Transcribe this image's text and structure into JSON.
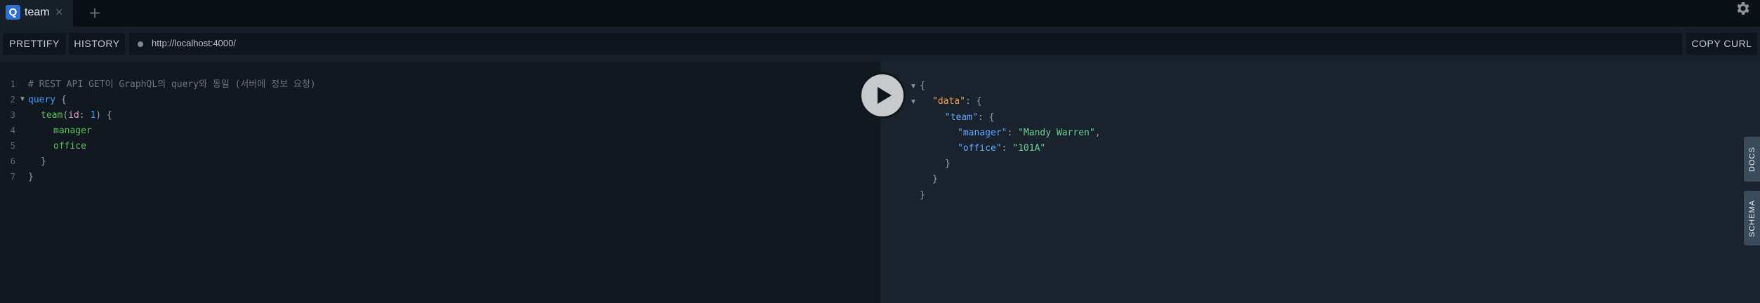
{
  "tab": {
    "badge": "Q",
    "title": "team",
    "close": "×",
    "add": "+"
  },
  "toolbar": {
    "prettify_label": "PRETTIFY",
    "history_label": "HISTORY",
    "url": "http://localhost:4000/",
    "copy_curl_label": "COPY CURL"
  },
  "editor": {
    "line_numbers": [
      "1",
      "2",
      "3",
      "4",
      "5",
      "6",
      "7"
    ],
    "comment": "# REST API GET이 GraphQL의 query와 동일 (서버에 정보 요청)",
    "query_kw": "query",
    "team_field": "team",
    "arg_name": "id",
    "arg_value": "1",
    "field1": "manager",
    "field2": "office"
  },
  "result": {
    "data_key": "\"data\"",
    "team_key": "\"team\"",
    "manager_key": "\"manager\"",
    "manager_value": "\"Mandy Warren\"",
    "office_key": "\"office\"",
    "office_value": "\"101A\""
  },
  "side_tabs": {
    "docs": "DOCS",
    "schema": "SCHEMA"
  },
  "icons": {
    "gear": "gear-icon",
    "play": "play-icon",
    "url_status": "status-dot-icon"
  }
}
